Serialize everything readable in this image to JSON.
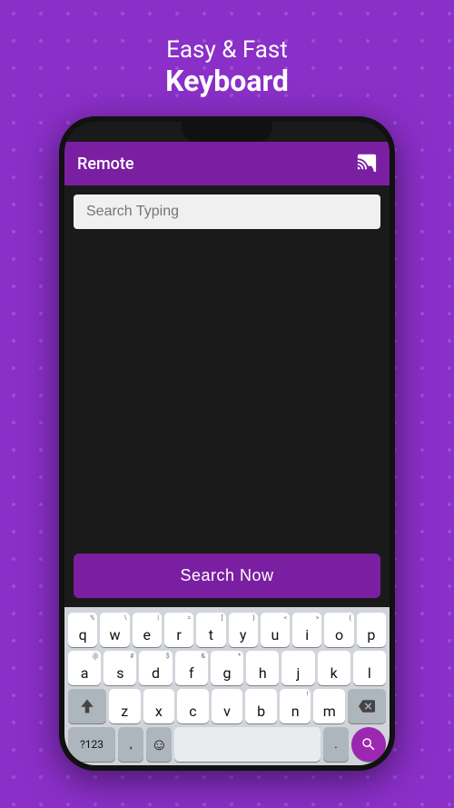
{
  "header": {
    "line1": "Easy & Fast",
    "line2": "Keyboard"
  },
  "topbar": {
    "title": "Remote",
    "cast_icon": "⬛"
  },
  "search": {
    "placeholder": "Search Typing",
    "button_label": "Search Now"
  },
  "keyboard": {
    "row1": [
      {
        "label": "q",
        "sup": "%"
      },
      {
        "label": "w",
        "sup": "\\"
      },
      {
        "label": "e",
        "sup": "|"
      },
      {
        "label": "r",
        "sup": "="
      },
      {
        "label": "t",
        "sup": "["
      },
      {
        "label": "y",
        "sup": "}"
      },
      {
        "label": "u",
        "sup": "<"
      },
      {
        "label": "i",
        "sup": ">"
      },
      {
        "label": "o",
        "sup": "{"
      },
      {
        "label": "p",
        "sup": ""
      }
    ],
    "row2": [
      {
        "label": "a",
        "sup": "@"
      },
      {
        "label": "s",
        "sup": "#"
      },
      {
        "label": "d",
        "sup": "$"
      },
      {
        "label": "f",
        "sup": "&"
      },
      {
        "label": "g",
        "sup": "*"
      },
      {
        "label": "h",
        "sup": ""
      },
      {
        "label": "j",
        "sup": ""
      },
      {
        "label": "k",
        "sup": ""
      },
      {
        "label": "l",
        "sup": ""
      }
    ],
    "row3": [
      {
        "label": "z",
        "sup": ""
      },
      {
        "label": "x",
        "sup": ""
      },
      {
        "label": "c",
        "sup": ""
      },
      {
        "label": "v",
        "sup": ""
      },
      {
        "label": "b",
        "sup": ""
      },
      {
        "label": "n",
        "sup": "!"
      },
      {
        "label": "m",
        "sup": ""
      }
    ],
    "bottom": {
      "numeric": "?123",
      "comma": ",",
      "emoji": "☺",
      "space": "",
      "period": ".",
      "search": "🔍"
    }
  }
}
